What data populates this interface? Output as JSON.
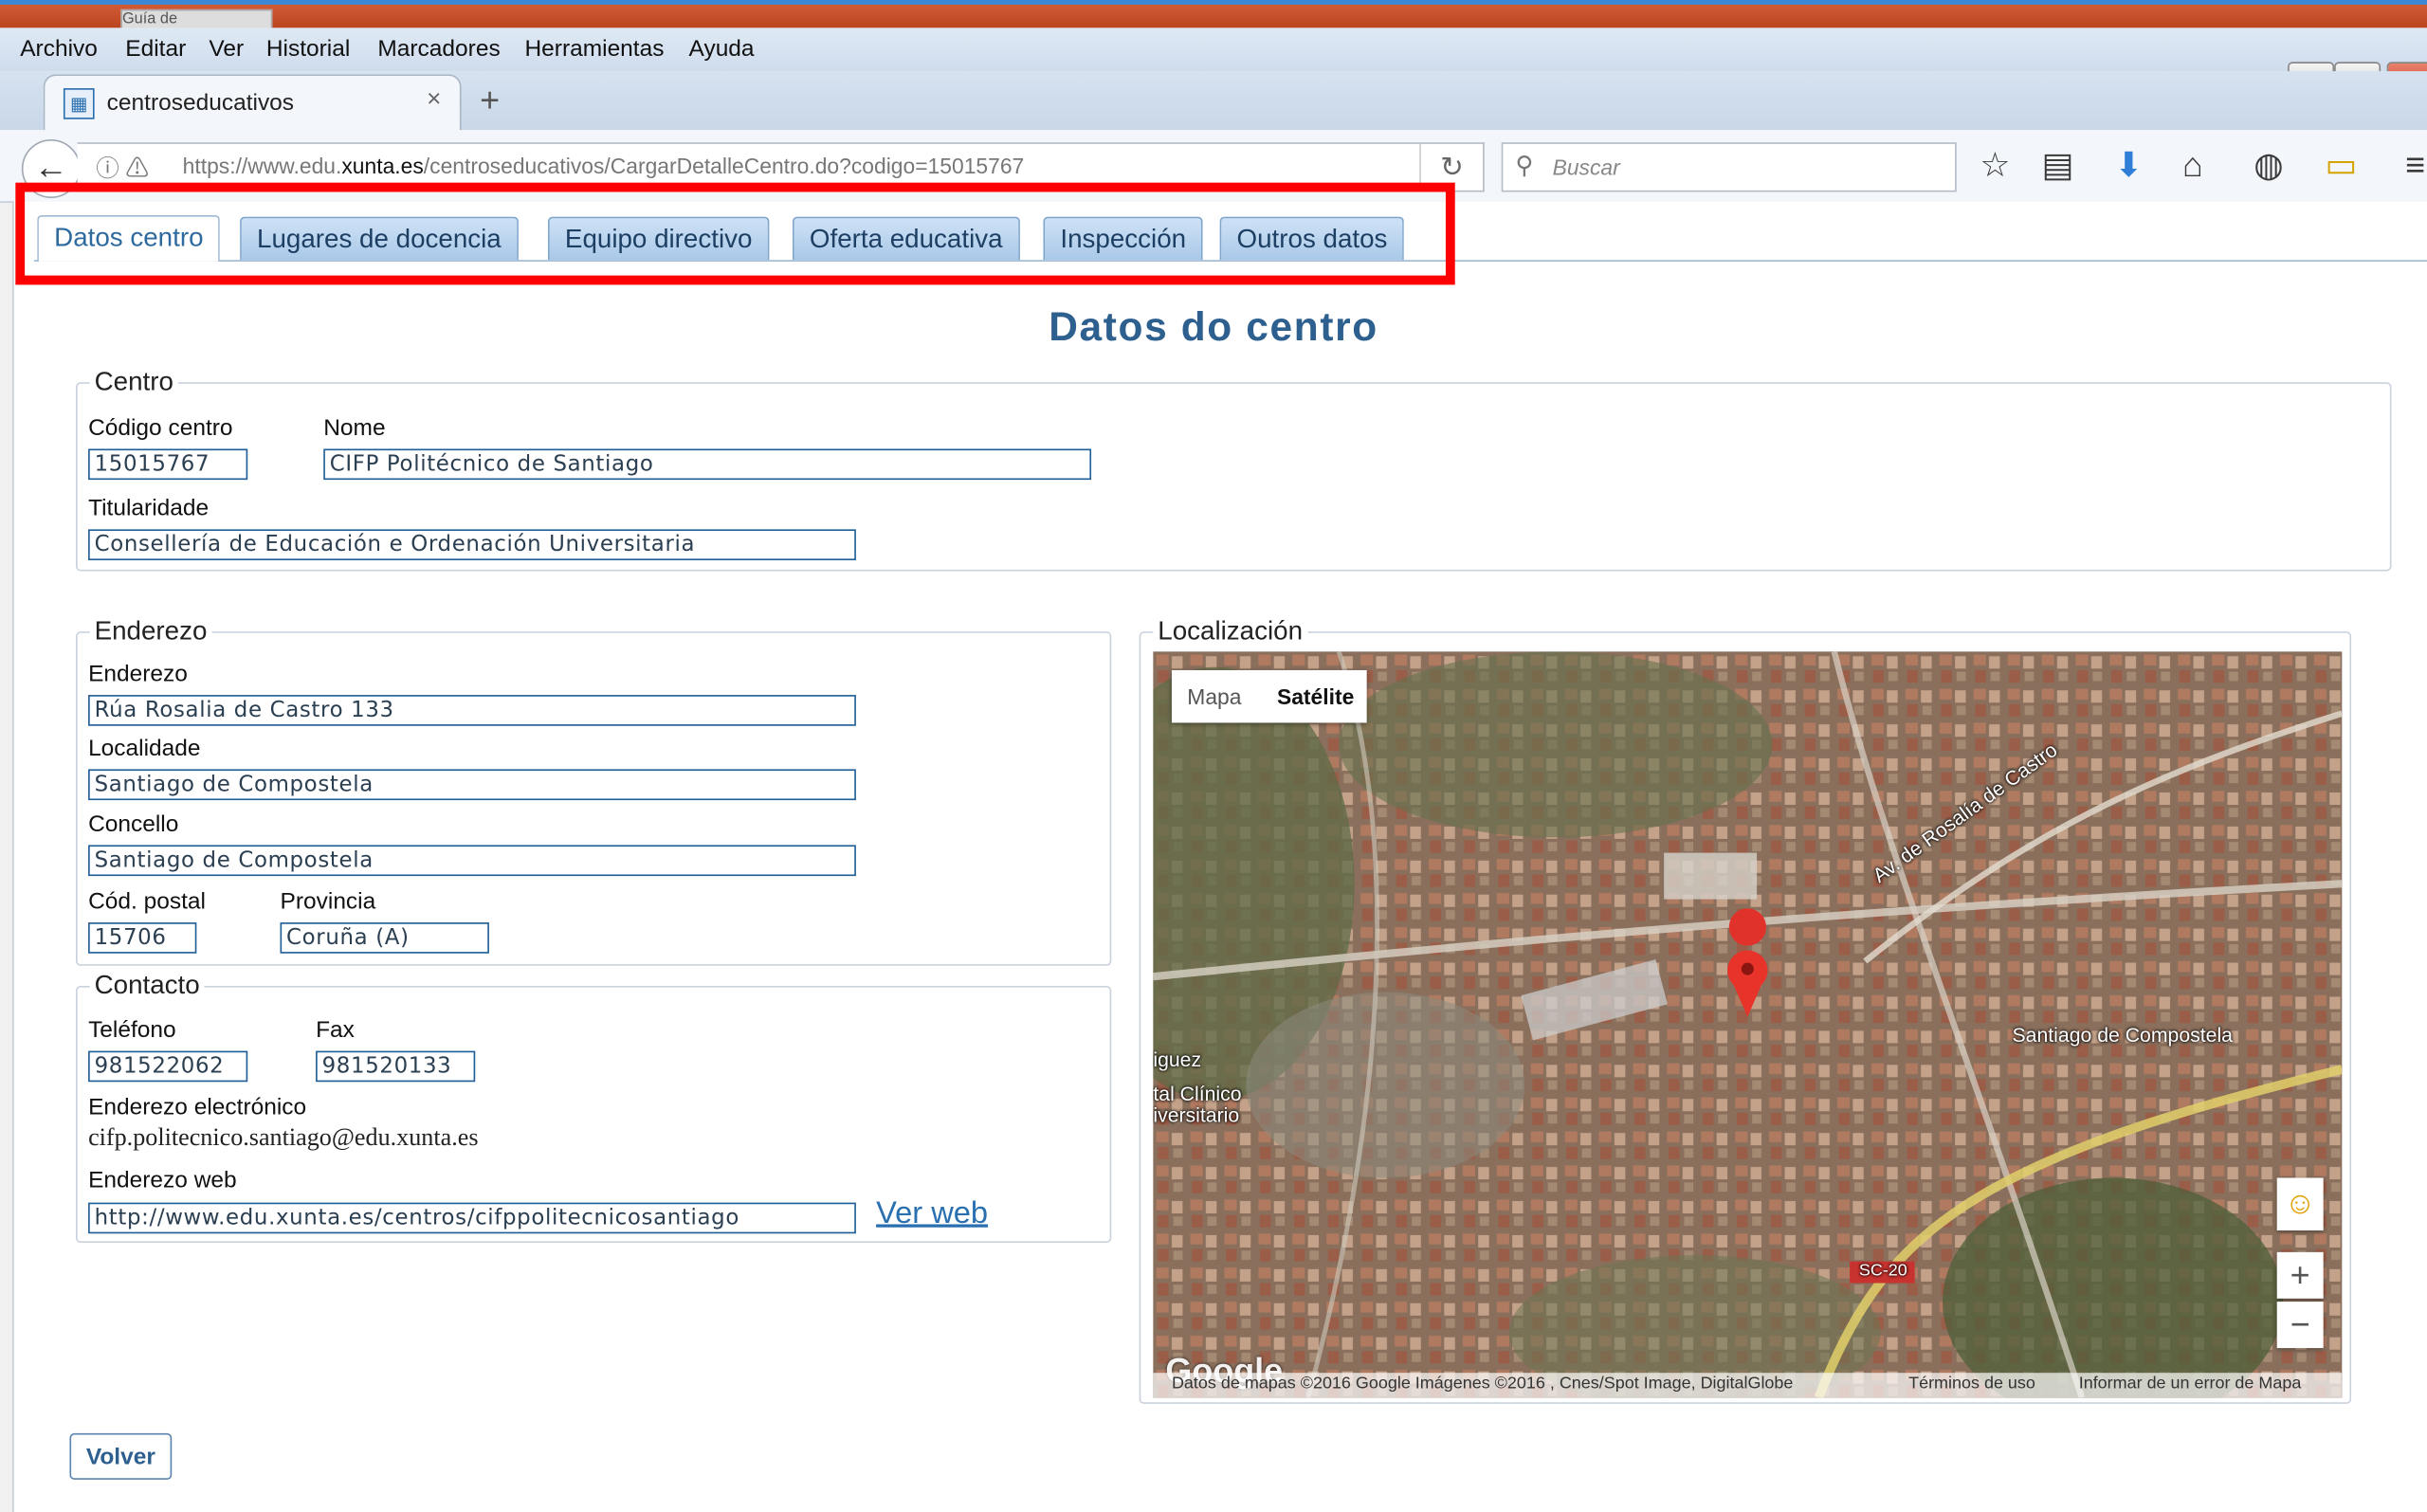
{
  "window": {
    "prev_tab_label": "Guía de",
    "menu": [
      "Archivo",
      "Editar",
      "Ver",
      "Historial",
      "Marcadores",
      "Herramientas",
      "Ayuda"
    ],
    "buttons": {
      "minimize": "–",
      "maximize": "□",
      "close": "x"
    }
  },
  "browser": {
    "tab_title": "centroseducativos",
    "tab_close": "×",
    "new_tab": "+",
    "url_prefix": "https://www.edu.",
    "url_domain": "xunta.es",
    "url_path": "/centroseducativos/CargarDetalleCentro.do?codigo=15015767",
    "search_placeholder": "Buscar"
  },
  "tabs": [
    "Datos centro",
    "Lugares de docencia",
    "Equipo directivo",
    "Oferta educativa",
    "Inspección",
    "Outros datos"
  ],
  "active_tab": "Datos centro",
  "page_title": "Datos do centro",
  "centro": {
    "legend": "Centro",
    "codigo_label": "Código centro",
    "codigo": "15015767",
    "nome_label": "Nome",
    "nome": "CIFP Politécnico de Santiago",
    "titularidade_label": "Titularidade",
    "titularidade": "Consellería de Educación e Ordenación Universitaria"
  },
  "enderezo": {
    "legend": "Enderezo",
    "enderezo_label": "Enderezo",
    "enderezo": "Rúa Rosalia de Castro 133",
    "localidade_label": "Localidade",
    "localidade": "Santiago de Compostela",
    "concello_label": "Concello",
    "concello": "Santiago de Compostela",
    "cp_label": "Cód. postal",
    "cp": "15706",
    "provincia_label": "Provincia",
    "provincia": "Coruña (A)"
  },
  "contacto": {
    "legend": "Contacto",
    "telefono_label": "Teléfono",
    "telefono": "981522062",
    "fax_label": "Fax",
    "fax": "981520133",
    "email_label": "Enderezo electrónico",
    "email": "cifp.politecnico.santiago@edu.xunta.es",
    "web_label": "Enderezo web",
    "web": "http://www.edu.xunta.es/centros/cifppolitecnicosantiago",
    "ver_web": "Ver web"
  },
  "localizacion": {
    "legend": "Localización",
    "map_btn_mapa": "Mapa",
    "map_btn_satelite": "Satélite",
    "selected_map_type": "Satélite",
    "labels": {
      "avenida": "Av. de Rosalía de Castro",
      "city": "Santiago de Compostela",
      "hospital_1": "iguez",
      "hospital_2": "tal Clínico",
      "hospital_3": "iversitario",
      "road": "SC-20"
    },
    "zoom_in": "+",
    "zoom_out": "−",
    "google": "Google",
    "attribution": "Datos de mapas ©2016 Google Imágenes ©2016 , Cnes/Spot Image, DigitalGlobe",
    "terms": "Términos de uso",
    "report": "Informar de un error de Mapa"
  },
  "volver": "Volver",
  "colors": {
    "highlight": "#ff0000",
    "title": "#2d5f8f",
    "link": "#2a6fb0",
    "input_border": "#1f5e96"
  }
}
